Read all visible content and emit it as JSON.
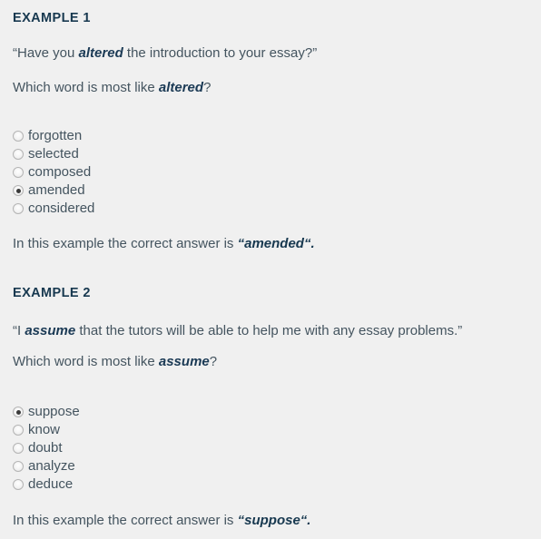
{
  "colors": {
    "background": "#f0f0f0",
    "body_text": "#44545f",
    "heading_text": "#17384f",
    "emphasis_text": "#1b3a55",
    "radio_border": "#b4b4b4",
    "radio_dot": "#3a3a3a"
  },
  "examples": [
    {
      "heading": "EXAMPLE 1",
      "quote_open": "“",
      "quote_lead": "Have you ",
      "quote_emphasis": "altered",
      "quote_tail": " the introduction to your essay?",
      "quote_close": "”",
      "prompt_lead": "Which word is most like ",
      "prompt_emphasis": "altered",
      "prompt_tail": "?",
      "options": [
        {
          "label": "forgotten",
          "checked": false
        },
        {
          "label": "selected",
          "checked": false
        },
        {
          "label": "composed",
          "checked": false
        },
        {
          "label": "amended",
          "checked": true
        },
        {
          "label": "considered",
          "checked": false
        }
      ],
      "answer_lead": "In this example the correct answer is ",
      "answer_value": "“amended“",
      "answer_tail": "."
    },
    {
      "heading": "EXAMPLE 2",
      "quote_open": "“",
      "quote_lead": "I ",
      "quote_emphasis": "assume",
      "quote_tail": " that the tutors will be able to help me with any essay problems.",
      "quote_close": "”",
      "prompt_lead": "Which word is most like ",
      "prompt_emphasis": "assume",
      "prompt_tail": "?",
      "options": [
        {
          "label": "suppose",
          "checked": true
        },
        {
          "label": "know",
          "checked": false
        },
        {
          "label": "doubt",
          "checked": false
        },
        {
          "label": "analyze",
          "checked": false
        },
        {
          "label": "deduce",
          "checked": false
        }
      ],
      "answer_lead": "In this example the correct answer is ",
      "answer_value": "“suppose“",
      "answer_tail": "."
    }
  ]
}
